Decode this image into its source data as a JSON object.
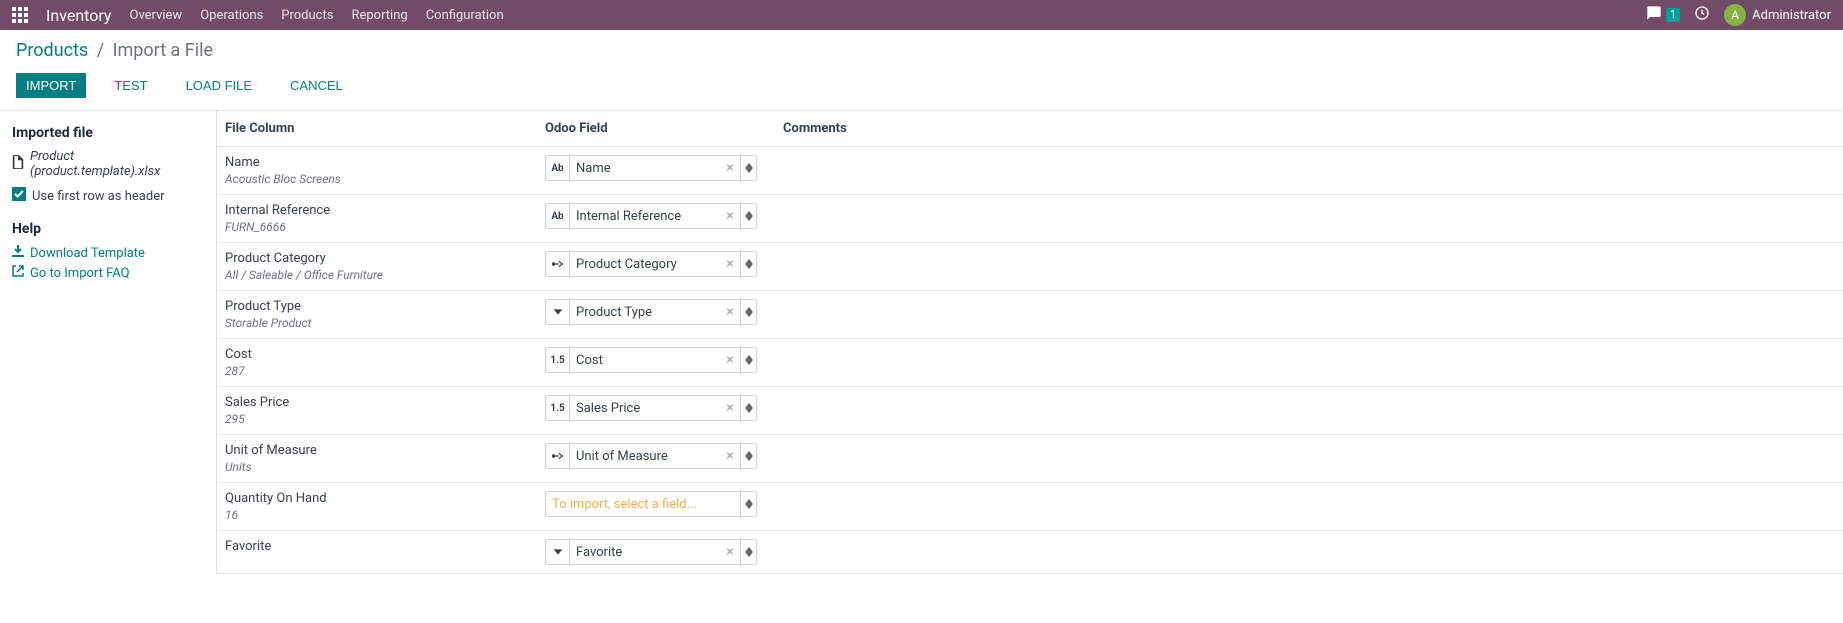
{
  "nav": {
    "app_name": "Inventory",
    "links": [
      "Overview",
      "Operations",
      "Products",
      "Reporting",
      "Configuration"
    ],
    "badge_count": "1",
    "avatar_letter": "A",
    "user_name": "Administrator"
  },
  "breadcrumb": {
    "parent": "Products",
    "current": "Import a File"
  },
  "actions": {
    "import": "IMPORT",
    "test": "TEST",
    "load_file": "LOAD FILE",
    "cancel": "CANCEL"
  },
  "sidebar": {
    "imported_file_header": "Imported file",
    "file_name": "Product (product.template).xlsx",
    "use_header_label": "Use first row as header",
    "help_header": "Help",
    "download_template": "Download Template",
    "go_to_faq": "Go to Import FAQ"
  },
  "headers": {
    "file_column": "File Column",
    "odoo_field": "Odoo Field",
    "comments": "Comments"
  },
  "rows": [
    {
      "label": "Name",
      "sample": "Acoustic Bloc Screens",
      "type": "text",
      "field": "Name"
    },
    {
      "label": "Internal Reference",
      "sample": "FURN_6666",
      "type": "text",
      "field": "Internal Reference"
    },
    {
      "label": "Product Category",
      "sample": "All / Saleable / Office Furniture",
      "type": "relation",
      "field": "Product Category"
    },
    {
      "label": "Product Type",
      "sample": "Storable Product",
      "type": "select",
      "field": "Product Type"
    },
    {
      "label": "Cost",
      "sample": "287",
      "type": "number",
      "field": "Cost"
    },
    {
      "label": "Sales Price",
      "sample": "295",
      "type": "number",
      "field": "Sales Price"
    },
    {
      "label": "Unit of Measure",
      "sample": "Units",
      "type": "relation",
      "field": "Unit of Measure"
    },
    {
      "label": "Quantity On Hand",
      "sample": "16",
      "type": "none",
      "field": "To import, select a field..."
    },
    {
      "label": "Favorite",
      "sample": "",
      "type": "select",
      "field": "Favorite"
    }
  ]
}
